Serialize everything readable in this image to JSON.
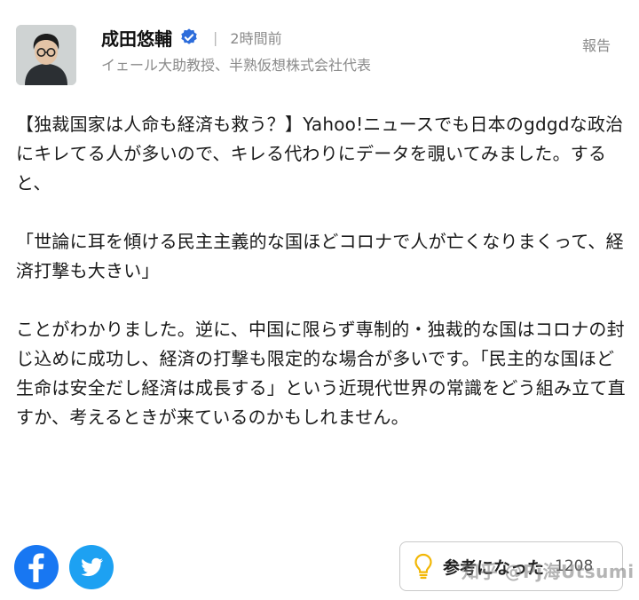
{
  "author": {
    "name": "成田悠輔",
    "posted": "2時間前",
    "separator": "|",
    "title": "イェール大助教授、半熟仮想株式会社代表"
  },
  "report_label": "報告",
  "body": {
    "paragraphs": [
      "【独裁国家は人命も経済も救う？】Yahoo!ニュースでも日本のgdgdな政治にキレてる人が多いので、キレる代わりにデータを覗いてみました。すると、",
      "「世論に耳を傾ける民主主義的な国ほどコロナで人が亡くなりまくって、経済打撃も大きい」",
      "ことがわかりました。逆に、中国に限らず専制的・独裁的な国はコロナの封じ込めに成功し、経済の打撃も限定的な場合が多いです。「民主的な国ほど生命は安全だし経済は成長する」という近現代世界の常識をどう組み立て直すか、考えるときが来ているのかもしれません。"
    ]
  },
  "share": {
    "facebook_icon": "facebook-icon",
    "twitter_icon": "twitter-icon"
  },
  "helpful": {
    "icon": "lightbulb-icon",
    "label": "参考になった",
    "count": "1208"
  },
  "watermark": "知乎 @Pj海Utsumi",
  "colors": {
    "facebook": "#1877f2",
    "twitter": "#1da1f2",
    "verified": "#2d6ddb",
    "muted_text": "#8a8a8a"
  }
}
